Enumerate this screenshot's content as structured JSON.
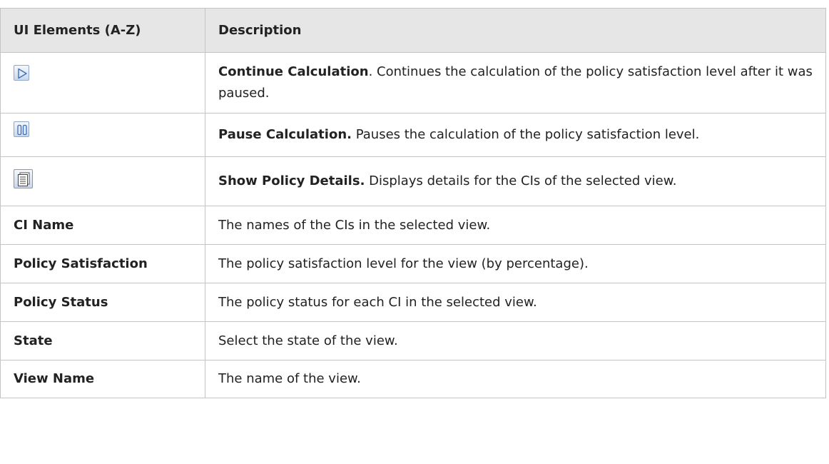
{
  "table": {
    "headers": {
      "elements": "UI Elements (A-Z)",
      "description": "Description"
    },
    "rows": [
      {
        "icon": "continue-icon",
        "desc_title": "Continue Calculation",
        "desc_text": ". Continues the calculation of the policy satisfaction level after it was paused."
      },
      {
        "icon": "pause-icon",
        "desc_title": "Pause Calculation.",
        "desc_text": " Pauses the calculation of the policy satisfaction level."
      },
      {
        "icon": "details-icon",
        "desc_title": "Show Policy Details.",
        "desc_text": " Displays details for the CIs of the selected view."
      },
      {
        "element": "CI Name",
        "desc_text": "The names of the CIs in the selected view."
      },
      {
        "element": "Policy Satisfaction",
        "desc_text": "The policy satisfaction level for the view (by percentage)."
      },
      {
        "element": "Policy Status",
        "desc_text": "The policy status for each CI in the selected view."
      },
      {
        "element": "State",
        "desc_text": "Select the state of the view."
      },
      {
        "element": "View Name",
        "desc_text": "The name of the view."
      }
    ]
  },
  "colors": {
    "header_bg": "#e6e6e6",
    "border": "#c4c4c4",
    "icon_blue": "#4a7cc4"
  }
}
